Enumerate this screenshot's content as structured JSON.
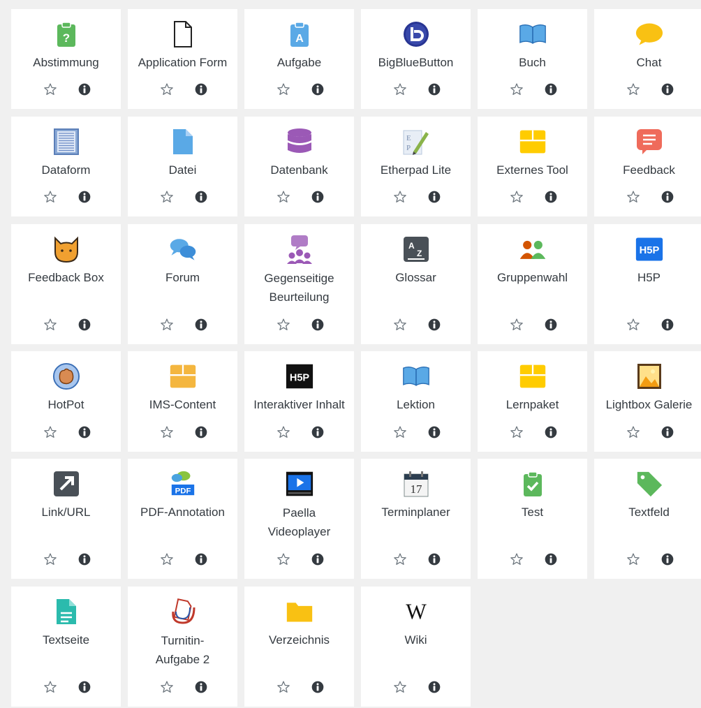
{
  "activities": [
    {
      "label": "Abstimmung",
      "icon": "choice-clipboard-question-icon",
      "color": "#5cb85c"
    },
    {
      "label": "Application Form",
      "icon": "blank-document-icon",
      "color": "#222222"
    },
    {
      "label": "Aufgabe",
      "icon": "assignment-clipboard-icon",
      "color": "#5aa9e6"
    },
    {
      "label": "BigBlueButton",
      "icon": "bigbluebutton-logo-icon",
      "color": "#283593"
    },
    {
      "label": "Buch",
      "icon": "open-book-icon",
      "color": "#5aa9e6"
    },
    {
      "label": "Chat",
      "icon": "speech-bubble-icon",
      "color": "#f9c113"
    },
    {
      "label": "Dataform",
      "icon": "dataform-sheet-icon",
      "color": "#8aa9d6"
    },
    {
      "label": "Datei",
      "icon": "file-icon",
      "color": "#5aa9e6"
    },
    {
      "label": "Datenbank",
      "icon": "database-icon",
      "color": "#9b59b6"
    },
    {
      "label": "Etherpad Lite",
      "icon": "etherpad-icon",
      "color": "#8ab34a"
    },
    {
      "label": "Externes Tool",
      "icon": "puzzle-box-icon",
      "color": "#ffcc00"
    },
    {
      "label": "Feedback",
      "icon": "feedback-message-icon",
      "color": "#ef6b5b"
    },
    {
      "label": "Feedback Box",
      "icon": "cat-face-icon",
      "color": "#f0a030"
    },
    {
      "label": "Forum",
      "icon": "forum-bubbles-icon",
      "color": "#5aa9e6"
    },
    {
      "label": "Gegenseitige\nBeurteilung",
      "icon": "workshop-people-icon",
      "color": "#9b59b6"
    },
    {
      "label": "Glossar",
      "icon": "glossary-az-icon",
      "color": "#495057"
    },
    {
      "label": "Gruppenwahl",
      "icon": "group-choice-icon",
      "color": "#d35400"
    },
    {
      "label": "H5P",
      "icon": "h5p-logo-icon",
      "color": "#1a73e8"
    },
    {
      "label": "HotPot",
      "icon": "hotpot-hand-icon",
      "color": "#3b6fb6"
    },
    {
      "label": "IMS-Content",
      "icon": "package-box-icon",
      "color": "#f4b63f"
    },
    {
      "label": "Interaktiver Inhalt",
      "icon": "h5p-dark-logo-icon",
      "color": "#111111"
    },
    {
      "label": "Lektion",
      "icon": "lesson-book-icon",
      "color": "#5aa9e6"
    },
    {
      "label": "Lernpaket",
      "icon": "scorm-package-icon",
      "color": "#ffcc00"
    },
    {
      "label": "Lightbox Galerie",
      "icon": "image-gallery-icon",
      "color": "#f39c12"
    },
    {
      "label": "Link/URL",
      "icon": "external-link-arrow-icon",
      "color": "#495057"
    },
    {
      "label": "PDF-Annotation",
      "icon": "pdf-annotation-icon",
      "color": "#1a73e8"
    },
    {
      "label": "Paella\nVideoplayer",
      "icon": "video-player-icon",
      "color": "#1a73e8"
    },
    {
      "label": "Terminplaner",
      "icon": "calendar-icon",
      "color": "#7f8c8d"
    },
    {
      "label": "Test",
      "icon": "quiz-check-icon",
      "color": "#5cb85c"
    },
    {
      "label": "Textfeld",
      "icon": "tag-label-icon",
      "color": "#5cb85c"
    },
    {
      "label": "Textseite",
      "icon": "text-page-icon",
      "color": "#2bbbad"
    },
    {
      "label": "Turnitin-\nAufgabe 2",
      "icon": "turnitin-icon",
      "color": "#c0392b"
    },
    {
      "label": "Verzeichnis",
      "icon": "folder-icon",
      "color": "#f9c113"
    },
    {
      "label": "Wiki",
      "icon": "wikipedia-w-icon",
      "color": "#111111"
    }
  ],
  "icons": {
    "star": "star-outline-icon",
    "info": "info-circle-icon",
    "star_color": "#6c757d",
    "info_color": "#343a40"
  }
}
